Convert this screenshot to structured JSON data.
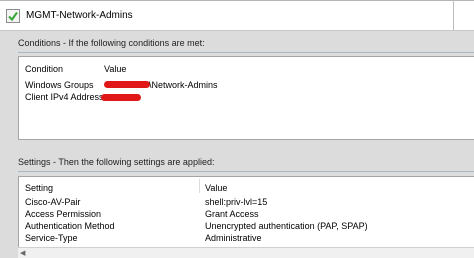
{
  "header": {
    "policy_name": "MGMT-Network-Admins"
  },
  "conditions": {
    "title": "Conditions - If the following conditions are met:",
    "columns": [
      "Condition",
      "Value"
    ],
    "rows": [
      {
        "condition": "Windows Groups",
        "value": "\\Network-Admins",
        "redacted": true
      },
      {
        "condition": "Client IPv4 Address",
        "value": "",
        "redacted": true
      }
    ]
  },
  "settings": {
    "title": "Settings - Then the following settings are applied:",
    "columns": [
      "Setting",
      "Value"
    ],
    "rows": [
      {
        "setting": "Cisco-AV-Pair",
        "value": "shell:priv-lvl=15"
      },
      {
        "setting": "Access Permission",
        "value": "Grant Access"
      },
      {
        "setting": "Authentication Method",
        "value": "Unencrypted authentication (PAP, SPAP)"
      },
      {
        "setting": "Service-Type",
        "value": "Administrative"
      }
    ]
  },
  "colors": {
    "redaction": "#e01818",
    "icon_green": "#3fa83f"
  },
  "icons": {
    "policy": "checkmark-policy-icon",
    "scroll": "scroll-left-arrow-icon"
  }
}
